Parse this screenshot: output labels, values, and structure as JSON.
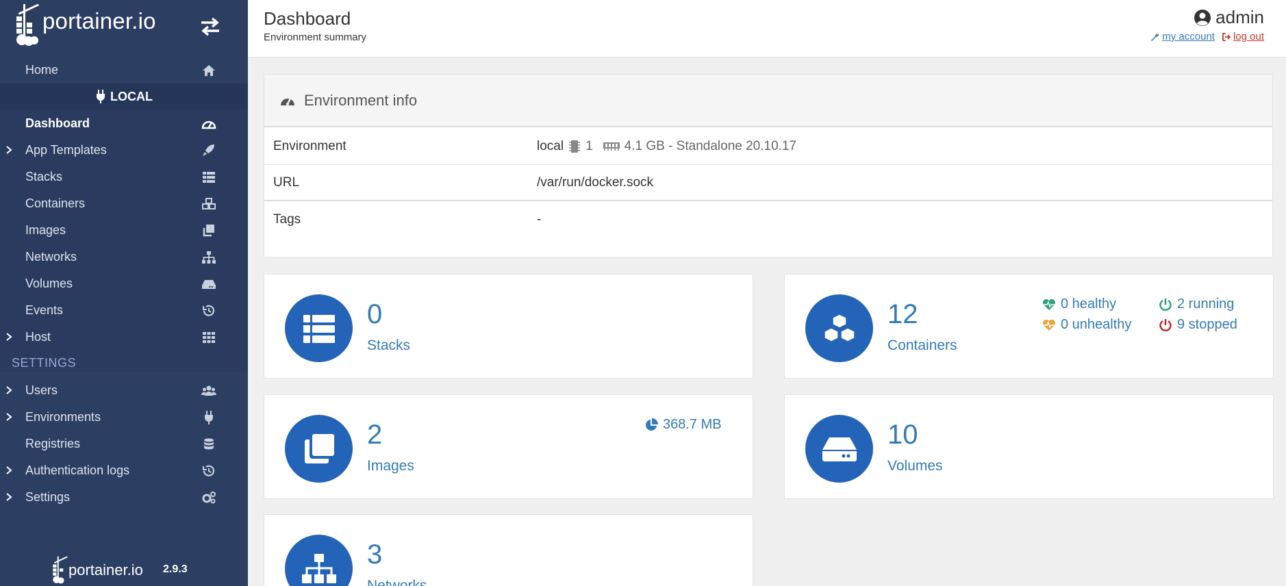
{
  "sidebar": {
    "brand": "portainer.io",
    "home": "Home",
    "environment": "LOCAL",
    "items": [
      {
        "label": "Dashboard"
      },
      {
        "label": "App Templates"
      },
      {
        "label": "Stacks"
      },
      {
        "label": "Containers"
      },
      {
        "label": "Images"
      },
      {
        "label": "Networks"
      },
      {
        "label": "Volumes"
      },
      {
        "label": "Events"
      },
      {
        "label": "Host"
      }
    ],
    "settings_heading": "SETTINGS",
    "settings_items": [
      {
        "label": "Users"
      },
      {
        "label": "Environments"
      },
      {
        "label": "Registries"
      },
      {
        "label": "Authentication logs"
      },
      {
        "label": "Settings"
      }
    ],
    "footer": {
      "brand": "portainer.io",
      "version": "2.9.3"
    }
  },
  "header": {
    "title": "Dashboard",
    "subtitle": "Environment summary",
    "user": "admin",
    "my_account": "my account",
    "log_out": "log out"
  },
  "env_info": {
    "title": "Environment info",
    "rows": {
      "environment": {
        "key": "Environment",
        "name": "local",
        "cpu": "1",
        "memory": "4.1 GB - Standalone 20.10.17"
      },
      "url": {
        "key": "URL",
        "value": "/var/run/docker.sock"
      },
      "tags": {
        "key": "Tags",
        "value": "-"
      }
    }
  },
  "stats": {
    "stacks": {
      "count": "0",
      "label": "Stacks"
    },
    "containers": {
      "count": "12",
      "label": "Containers",
      "healthy": "0 healthy",
      "unhealthy": "0 unhealthy",
      "running": "2 running",
      "stopped": "9 stopped"
    },
    "images": {
      "count": "2",
      "label": "Images",
      "size": "368.7 MB"
    },
    "volumes": {
      "count": "10",
      "label": "Volumes"
    },
    "networks": {
      "count": "3",
      "label": "Networks"
    }
  },
  "colors": {
    "sidebar": "#2d3e63",
    "accent": "#337ab7",
    "icon_circle": "#2364b8",
    "healthy": "#2ea37a",
    "unhealthy": "#e8a33a",
    "running": "#2ea37a",
    "stopped": "#c0282d"
  }
}
